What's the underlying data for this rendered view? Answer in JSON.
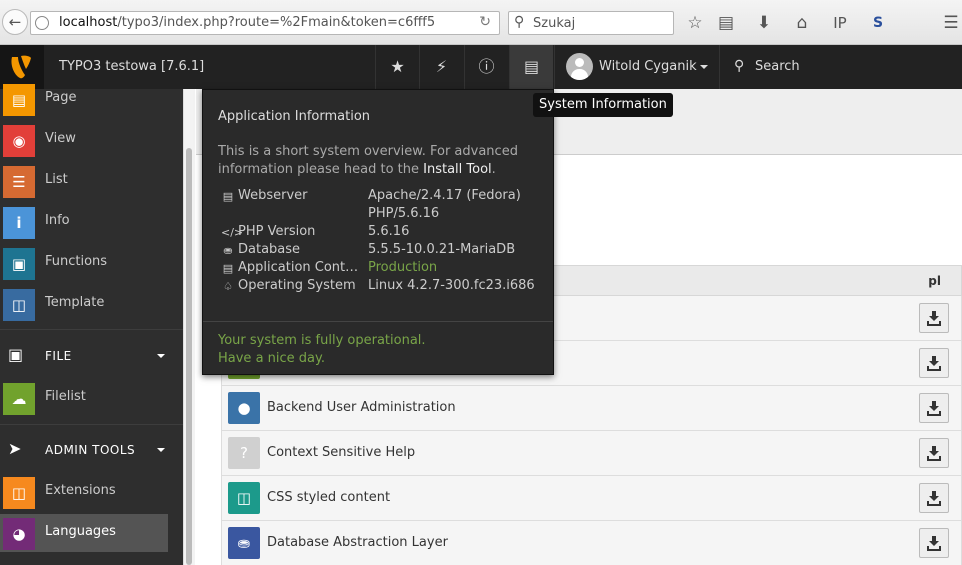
{
  "browser": {
    "url_host": "localhost",
    "url_rest": "/typo3/index.php?route=%2Fmain&token=c6fff5",
    "search_placeholder": "Szukaj"
  },
  "topbar": {
    "site_name": "TYPO3 testowa [7.6.1]",
    "user_name": "Witold Cyganik",
    "search_label": "Search",
    "tooltip": "System Information"
  },
  "sidebar": {
    "web_items": [
      {
        "label": "Page",
        "icon": "page-icon",
        "color": "#f49700"
      },
      {
        "label": "View",
        "icon": "eye-icon",
        "color": "#e23f39"
      },
      {
        "label": "List",
        "icon": "list-icon",
        "color": "#d66a32"
      },
      {
        "label": "Info",
        "icon": "info-icon",
        "color": "#4b94d8"
      },
      {
        "label": "Functions",
        "icon": "toolbox-icon",
        "color": "#1e7491"
      },
      {
        "label": "Template",
        "icon": "template-icon",
        "color": "#386ba0"
      }
    ],
    "file_group": "FILE",
    "file_items": [
      {
        "label": "Filelist",
        "icon": "filelist-icon",
        "color": "#71a22d"
      }
    ],
    "admin_group": "ADMIN TOOLS",
    "admin_items": [
      {
        "label": "Extensions",
        "icon": "extensions-icon",
        "color": "#f6891e"
      },
      {
        "label": "Languages",
        "icon": "globe-icon",
        "color": "#732b77"
      }
    ]
  },
  "content": {
    "column_label": "pl",
    "rows": [
      {
        "label": "",
        "icon_color": "#71a22d"
      },
      {
        "label": "",
        "icon_color": "#71a22d"
      },
      {
        "label": "Backend User Administration",
        "icon_color": "#3a73a8"
      },
      {
        "label": "Context Sensitive Help",
        "icon_color": "#d0d0d0"
      },
      {
        "label": "CSS styled content",
        "icon_color": "#1c9a8b"
      },
      {
        "label": "Database Abstraction Layer",
        "icon_color": "#3a57a0"
      }
    ]
  },
  "popup": {
    "title": "Application Information",
    "desc_prefix": "This is a short system overview. For advanced information please head to the ",
    "desc_link": "Install Tool",
    "desc_suffix": ".",
    "rows": [
      {
        "label": "Webserver",
        "value": "Apache/2.4.17 (Fedora)",
        "value2": "PHP/5.6.16"
      },
      {
        "label": "PHP Version",
        "value": "5.6.16"
      },
      {
        "label": "Database",
        "value": "5.5.5-10.0.21-MariaDB"
      },
      {
        "label": "Application Context",
        "value": "Production"
      },
      {
        "label": "Operating System",
        "value": "Linux 4.2.7-300.fc23.i686"
      }
    ],
    "status_line1": "Your system is fully operational.",
    "status_line2": "Have a nice day."
  }
}
